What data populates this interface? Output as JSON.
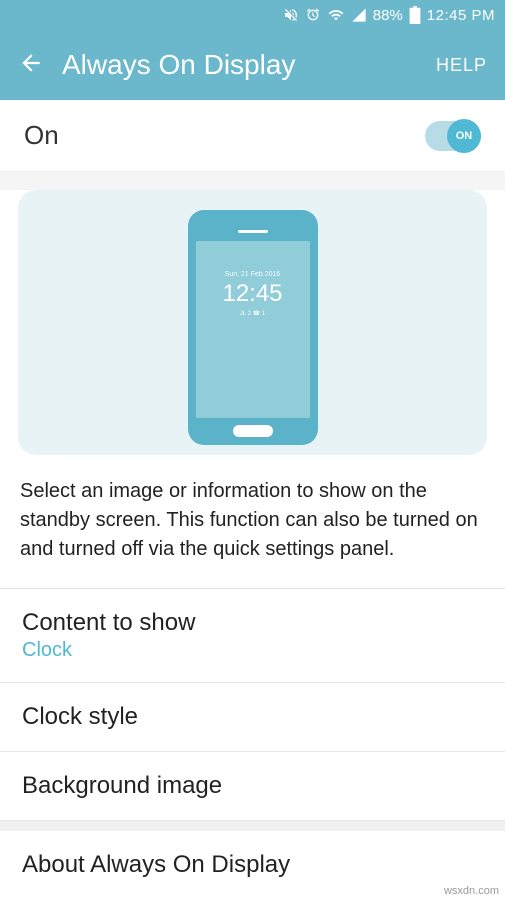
{
  "status": {
    "battery_pct": "88%",
    "time": "12:45 PM"
  },
  "header": {
    "title": "Always On Display",
    "help": "HELP"
  },
  "toggle": {
    "label": "On",
    "knob": "ON"
  },
  "preview": {
    "date": "Sun, 21 Feb 2016",
    "time": "12:45",
    "sub": "JL 2   ☎ 1"
  },
  "description": "Select an image or information to show on the standby screen. This function can also be turned on and turned off via the quick settings panel.",
  "items": {
    "content_to_show": {
      "title": "Content to show",
      "value": "Clock"
    },
    "clock_style": {
      "title": "Clock style"
    },
    "background_image": {
      "title": "Background image"
    },
    "about": {
      "title": "About Always On Display"
    }
  },
  "watermark": "wsxdn.com"
}
